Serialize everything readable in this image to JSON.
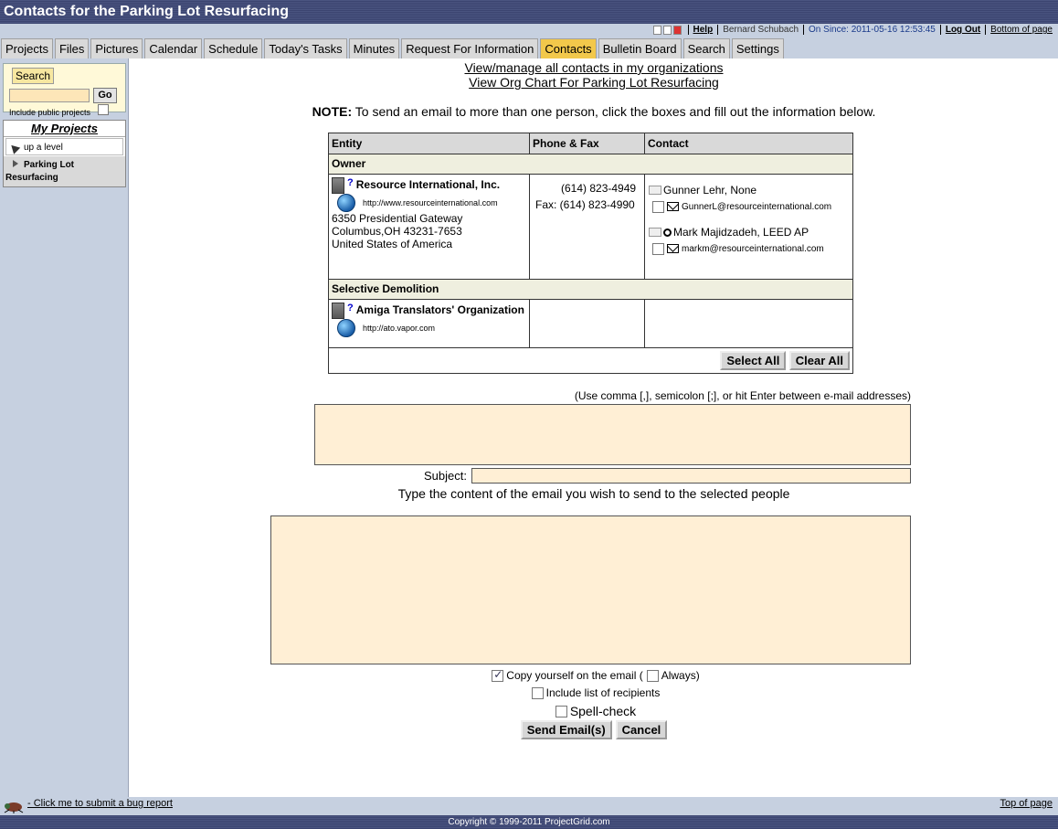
{
  "title": "Contacts for the Parking Lot Resurfacing",
  "util": {
    "help": "Help",
    "user": "Bernard Schubach",
    "since": "On Since: 2011-05-16 12:53:45",
    "logout": "Log Out",
    "bottom": "Bottom of page"
  },
  "tabs": [
    "Projects",
    "Files",
    "Pictures",
    "Calendar",
    "Schedule",
    "Today's Tasks",
    "Minutes",
    "Request For Information",
    "Contacts",
    "Bulletin Board",
    "Search",
    "Settings"
  ],
  "active_tab": "Contacts",
  "sidebar": {
    "search_label": "Search",
    "go": "Go",
    "include_public": "Include public projects",
    "my_projects": "My Projects",
    "up_level": "up a level",
    "project": "Parking Lot Resurfacing"
  },
  "links": {
    "manage": "View/manage all contacts in my organizations",
    "orgchart": "View Org Chart For Parking Lot Resurfacing"
  },
  "note": {
    "label": "NOTE:",
    "text": " To send an email to more than one person, click the boxes and fill out the information below."
  },
  "table": {
    "headers": {
      "entity": "Entity",
      "phone": "Phone & Fax",
      "contact": "Contact"
    },
    "group1": "Owner",
    "org1": {
      "name": "Resource International, Inc.",
      "url": "http://www.resourceinternational.com",
      "addr1": "6350 Presidential Gateway",
      "addr2": "Columbus,OH 43231-7653",
      "addr3": "United States of America",
      "phone": "(614) 823-4949",
      "fax": "Fax: (614) 823-4990",
      "c1_name": "Gunner Lehr, None",
      "c1_email": "GunnerL@resourceinternational.com",
      "c2_name": "Mark Majidzadeh, LEED AP",
      "c2_email": "markm@resourceinternational.com"
    },
    "group2": "Selective Demolition",
    "org2": {
      "name": "Amiga Translators' Organization",
      "url": "http://ato.vapor.com"
    },
    "select_all": "Select All",
    "clear_all": "Clear All"
  },
  "form": {
    "hint": "(Use comma [,], semicolon [;], or hit Enter between e-mail addresses)",
    "subject": "Subject:",
    "content_label": "Type the content of the email you wish to send to the selected people",
    "copy_self": "Copy yourself on the email (",
    "always": "Always)",
    "include_list": "Include list of recipients",
    "spell": "Spell-check",
    "send": "Send Email(s)",
    "cancel": "Cancel"
  },
  "footer": {
    "bug": " - Click me to submit a bug report",
    "top": "Top of page",
    "copyright": "Copyright © 1999-2011 ProjectGrid.com"
  }
}
